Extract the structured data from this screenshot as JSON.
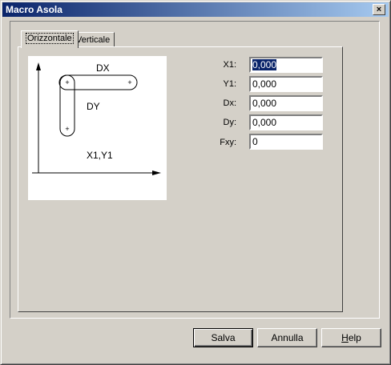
{
  "window": {
    "title": "Macro Asola",
    "close_glyph": "×"
  },
  "tabs": [
    {
      "label": "Orizzontale",
      "active": true
    },
    {
      "label": "Verticale",
      "active": false
    }
  ],
  "diagram": {
    "dx_label": "DX",
    "dy_label": "DY",
    "origin_label": "X1,Y1",
    "plus": "+"
  },
  "fields": [
    {
      "label": "X1:",
      "value": "0,000"
    },
    {
      "label": "Y1:",
      "value": "0,000"
    },
    {
      "label": "Dx:",
      "value": "0,000"
    },
    {
      "label": "Dy:",
      "value": "0,000"
    },
    {
      "label": "Fxy:",
      "value": "0"
    }
  ],
  "buttons": {
    "save": "Salva",
    "cancel": "Annulla",
    "help_first": "H",
    "help_rest": "elp"
  }
}
